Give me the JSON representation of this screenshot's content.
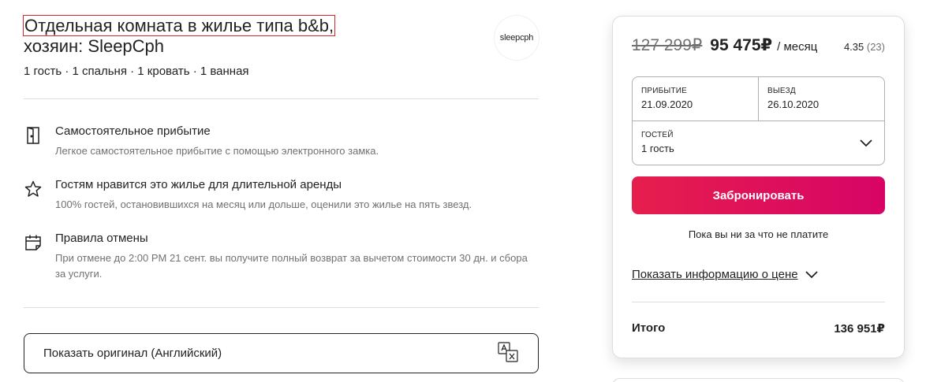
{
  "listing": {
    "title_part1": "Отдельная комната в жилье типа b&b,",
    "title_part2": "хозяин: SleepCph",
    "subtitle": "1 гость · 1 спальня · 1 кровать · 1 ванная",
    "host_logo_text": "sleepcph"
  },
  "features": [
    {
      "icon": "door-icon",
      "title": "Самостоятельное прибытие",
      "desc": "Легкое самостоятельное прибытие с помощью электронного замка."
    },
    {
      "icon": "star-icon",
      "title": "Гостям нравится это жилье для длительной аренды",
      "desc": "100% гостей, остановившихся на месяц или дольше, оценили это жилье на пять звезд."
    },
    {
      "icon": "calendar-icon",
      "title": "Правила отмены",
      "desc": "При отмене до 2:00 PM 21 сент. вы получите полный возврат за вычетом стоимости 30 дн. и сбора за услуги."
    }
  ],
  "show_original": {
    "label": "Показать оригинал (Английский)",
    "icon": "translate-icon"
  },
  "booking": {
    "old_price": "127 299₽",
    "new_price": "95 475₽",
    "period": "/ месяц",
    "rating": "4.35",
    "reviews": "(23)",
    "checkin_label": "Прибытие",
    "checkin_value": "21.09.2020",
    "checkout_label": "Выезд",
    "checkout_value": "26.10.2020",
    "guests_label": "Гостей",
    "guests_value": "1 гость",
    "book_button": "Забронировать",
    "no_charge_note": "Пока вы ни за что не платите",
    "price_info_link": "Показать информацию о цене",
    "total_label": "Итого",
    "total_value": "136 951₽"
  },
  "colors": {
    "accent_start": "#e61e4d",
    "accent_end": "#d70466",
    "text": "#222222",
    "muted": "#717171"
  }
}
